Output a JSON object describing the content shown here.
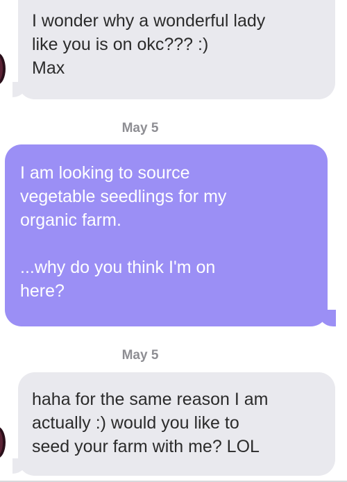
{
  "messages": [
    {
      "direction": "incoming",
      "text": "I wonder why a wonderful lady\nlike you is on okc??? :)\nMax"
    },
    {
      "direction": "outgoing",
      "text": "I am looking to source\nvegetable seedlings for my\norganic farm.\n\n...why do you think I'm on\nhere?"
    },
    {
      "direction": "incoming",
      "text": "haha for the same reason I am\nactually :) would you like to\nseed your farm with me? LOL"
    }
  ],
  "timestamps": [
    "May 5",
    "May 5"
  ],
  "colors": {
    "incoming_bubble": "#e9e9ee",
    "outgoing_bubble": "#9b8ff5",
    "timestamp_text": "#8e8e93"
  }
}
